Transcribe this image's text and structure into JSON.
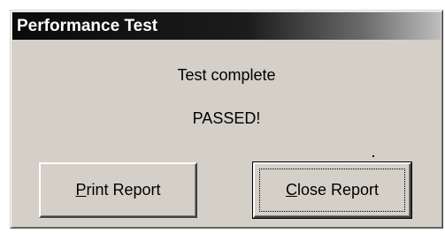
{
  "window": {
    "title": "Performance Test"
  },
  "message": {
    "line1": "Test complete",
    "line2": "PASSED!"
  },
  "buttons": {
    "print": {
      "mnemonic": "P",
      "rest": "rint Report"
    },
    "close": {
      "mnemonic": "C",
      "rest": "lose Report"
    }
  },
  "colors": {
    "face": "#d4d0c8",
    "title_start": "#0a0a0a",
    "title_end": "#bdbdbd"
  }
}
